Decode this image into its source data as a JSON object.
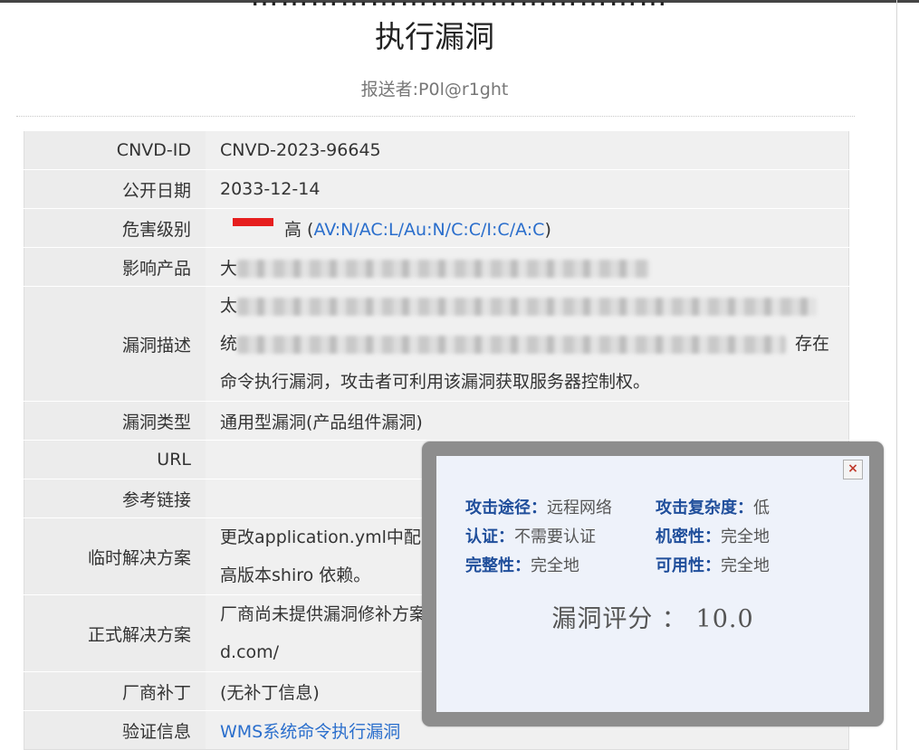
{
  "page": {
    "title_partial": "……………………………………",
    "title": "执行漏洞",
    "reporter": "报送者:P0l@r1ght"
  },
  "details": {
    "cnvd_id": {
      "label": "CNVD-ID",
      "value": "CNVD-2023-96645"
    },
    "publish_date": {
      "label": "公开日期",
      "value": "2033-12-14"
    },
    "severity": {
      "label": "危害级别",
      "level": "高",
      "open_paren": " (",
      "vector": "AV:N/AC:L/Au:N/C:C/I:C/A:C",
      "close_paren": ")",
      "bar_color": "#e61e1e"
    },
    "product": {
      "label": "影响产品",
      "prefix": "大"
    },
    "description": {
      "label": "漏洞描述",
      "line1_prefix": "太",
      "line2_prefix": "统",
      "line2_suffix": "存在",
      "line3": "命令执行漏洞，攻击者可利用该漏洞获取服务器控制权。"
    },
    "vuln_type": {
      "label": "漏洞类型",
      "value": "通用型漏洞(产品组件漏洞)"
    },
    "url": {
      "label": "URL",
      "value": ""
    },
    "reference": {
      "label": "参考链接",
      "value": ""
    },
    "workaround": {
      "label": "临时解决方案",
      "line1": "更改application.yml中配置",
      "line2": "高版本shiro 依赖。"
    },
    "solution": {
      "label": "正式解决方案",
      "line1": "厂商尚未提供漏洞修补方案",
      "line2": "d.com/"
    },
    "patch": {
      "label": "厂商补丁",
      "value": "(无补丁信息)"
    },
    "verification": {
      "label": "验证信息",
      "value": "WMS系统命令执行漏洞"
    }
  },
  "popup": {
    "close_glyph": "×",
    "metrics": [
      [
        {
          "key": "攻击途径：",
          "value": "远程网络"
        },
        {
          "key": "攻击复杂度：",
          "value": "低"
        }
      ],
      [
        {
          "key": "认证：",
          "value": "不需要认证"
        },
        {
          "key": "机密性：",
          "value": "完全地"
        }
      ],
      [
        {
          "key": "完整性：",
          "value": "完全地"
        },
        {
          "key": "可用性：",
          "value": "完全地"
        }
      ]
    ],
    "score_label": "漏洞评分 ：",
    "score_value": "10.0"
  },
  "colors": {
    "link": "#2a6ecc",
    "metric_key": "#1f4e9b",
    "popup_frame": "#8d8d8d",
    "popup_bg": "#eef2fa"
  }
}
